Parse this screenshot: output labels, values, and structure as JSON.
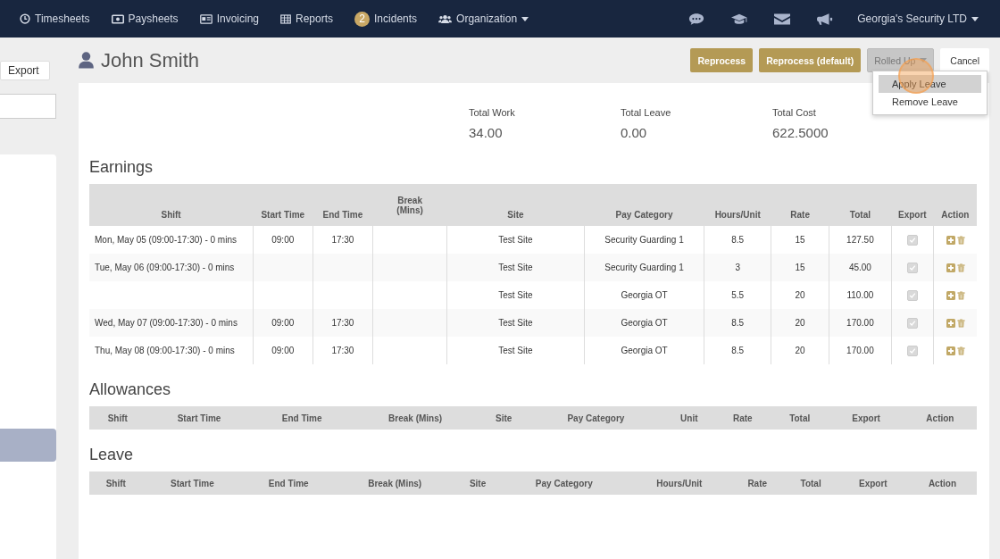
{
  "navbar": {
    "items": [
      {
        "label": "Timesheets"
      },
      {
        "label": "Paysheets"
      },
      {
        "label": "Invoicing"
      },
      {
        "label": "Reports"
      },
      {
        "label": "Incidents",
        "badge": "2"
      },
      {
        "label": "Organization",
        "dropdown": true
      }
    ],
    "account": {
      "label": "Georgia's Security LTD",
      "dropdown": true
    }
  },
  "sidebar": {
    "export_button": "Export"
  },
  "header": {
    "name": "John Smith",
    "buttons": [
      {
        "label": "Reprocess",
        "kind": "primary"
      },
      {
        "label": "Reprocess (default)",
        "kind": "primary"
      },
      {
        "label": "Rolled Up",
        "kind": "dropdown",
        "expanded": true
      },
      {
        "label": "Cancel",
        "kind": "plain"
      }
    ],
    "menu": [
      {
        "label": "Apply Leave",
        "selected": true
      },
      {
        "label": "Remove Leave",
        "selected": false
      }
    ]
  },
  "summary": [
    {
      "label": "Total Work",
      "value": "34.00"
    },
    {
      "label": "Total Leave",
      "value": "0.00"
    },
    {
      "label": "Total Cost",
      "value": "622.5000"
    }
  ],
  "earnings": {
    "title": "Earnings",
    "columns": [
      "Shift",
      "Start Time",
      "End Time",
      "Break (Mins)",
      "Site",
      "Pay Category",
      "Hours/Unit",
      "Rate",
      "Total",
      "Export",
      "Action"
    ],
    "rows": [
      {
        "cells": [
          "Mon, May 05 (09:00-17:30) - 0 mins",
          "09:00",
          "17:30",
          "",
          "Test Site",
          "Security Guarding 1",
          "8.5",
          "15",
          "127.50"
        ],
        "export": true
      },
      {
        "cells": [
          "Tue, May 06 (09:00-17:30) - 0 mins",
          "",
          "",
          "",
          "Test Site",
          "Security Guarding 1",
          "3",
          "15",
          "45.00"
        ],
        "export": true
      },
      {
        "cells": [
          "",
          "",
          "",
          "",
          "Test Site",
          "Georgia OT",
          "5.5",
          "20",
          "110.00"
        ],
        "export": true
      },
      {
        "cells": [
          "Wed, May 07 (09:00-17:30) - 0 mins",
          "09:00",
          "17:30",
          "",
          "Test Site",
          "Georgia OT",
          "8.5",
          "20",
          "170.00"
        ],
        "export": true
      },
      {
        "cells": [
          "Thu, May 08 (09:00-17:30) - 0 mins",
          "09:00",
          "17:30",
          "",
          "Test Site",
          "Georgia OT",
          "8.5",
          "20",
          "170.00"
        ],
        "export": true
      }
    ]
  },
  "allowances": {
    "title": "Allowances",
    "columns": [
      "Shift",
      "Start Time",
      "End Time",
      "Break (Mins)",
      "Site",
      "Pay Category",
      "Unit",
      "Rate",
      "Total",
      "Export",
      "Action"
    ]
  },
  "leave": {
    "title": "Leave",
    "columns": [
      "Shift",
      "Start Time",
      "End Time",
      "Break (Mins)",
      "Site",
      "Pay Category",
      "Hours/Unit",
      "Rate",
      "Total",
      "Export",
      "Action"
    ]
  }
}
